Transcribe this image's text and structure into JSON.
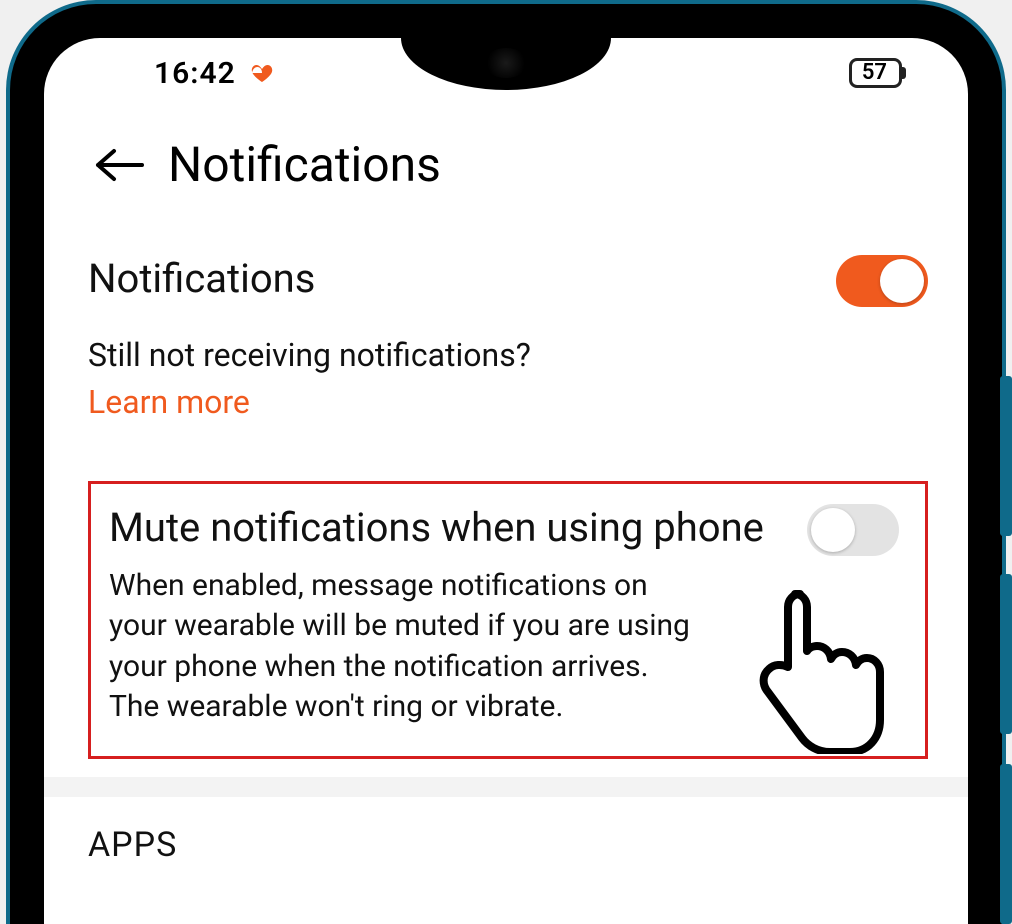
{
  "status_bar": {
    "time": "16:42",
    "battery_level": "57"
  },
  "header": {
    "title": "Notifications"
  },
  "settings": {
    "notifications_label": "Notifications",
    "help_question": "Still not receiving notifications?",
    "learn_more_label": "Learn more",
    "mute": {
      "title": "Mute notifications when using phone",
      "description": "When enabled, message notifications on your wearable will be muted if you are using your phone when the notification arrives. The wearable won't ring or vibrate."
    },
    "apps_header": "APPS"
  },
  "colors": {
    "accent": "#f05a1e",
    "highlight_border": "#d61f1f"
  }
}
